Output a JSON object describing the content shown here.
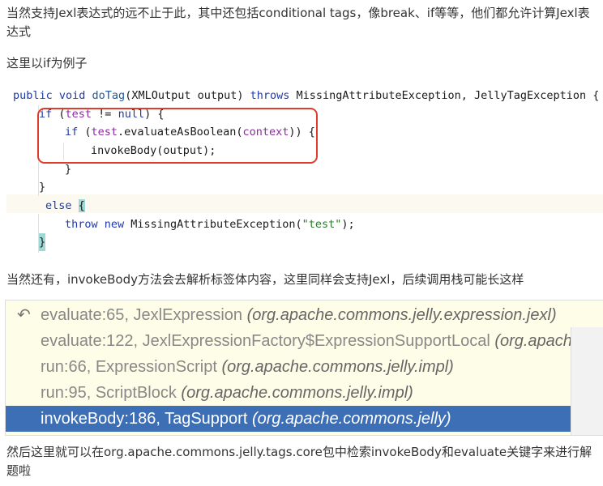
{
  "paragraphs": {
    "intro": "当然支持Jexl表达式的远不止于此，其中还包括conditional tags，像break、if等等，他们都允许计算Jexl表达式",
    "example": "这里以if为例子",
    "invoke": "当然还有，invokeBody方法会去解析标签体内容，这里同样会支持Jexl，后续调用栈可能长这样",
    "conclusion": "然后这里就可以在org.apache.commons.jelly.tags.core包中检索invokeBody和evaluate关键字来进行解题啦"
  },
  "code": {
    "l1": {
      "a": "public void ",
      "b": "doTag",
      "c": "(XMLOutput output) ",
      "d": "throws",
      "e": " MissingAttributeException, JellyTagException {"
    },
    "l2": {
      "a": "if",
      "b": " (",
      "c": "test",
      "d": " != ",
      "e": "null",
      "f": ") {"
    },
    "l3": {
      "a": "if",
      "b": " (",
      "c": "test",
      ".d": "",
      "d": ".evaluateAsBoolean(",
      "e": "context",
      "f": ")) {"
    },
    "l4": "invokeBody(output);",
    "l5": "}",
    "l6": "}",
    "l7": {
      "a": "else ",
      "b": "{"
    },
    "l8": {
      "a": "throw new",
      "b": " MissingAttributeException(",
      "c": "\"test\"",
      "d": ");"
    },
    "l9": "}"
  },
  "stack": {
    "frames": [
      {
        "method": "evaluate:65, JexlExpression ",
        "pkg": "(org.apache.commons.jelly.expression.jexl)"
      },
      {
        "method": "evaluate:122, JexlExpressionFactory$ExpressionSupportLocal ",
        "pkg": "(org.apache.commons.jelly.expression.jexl)"
      },
      {
        "method": "run:66, ExpressionScript ",
        "pkg": "(org.apache.commons.jelly.impl)"
      },
      {
        "method": "run:95, ScriptBlock ",
        "pkg": "(org.apache.commons.jelly.impl)"
      },
      {
        "method": "invokeBody:186, TagSupport ",
        "pkg": "(org.apache.commons.jelly)"
      }
    ],
    "selected_index": 4,
    "first_icon": "return-arrow-icon"
  },
  "colors": {
    "highlight_box": "#e03c2c",
    "selected_row": "#3d6fb6"
  }
}
